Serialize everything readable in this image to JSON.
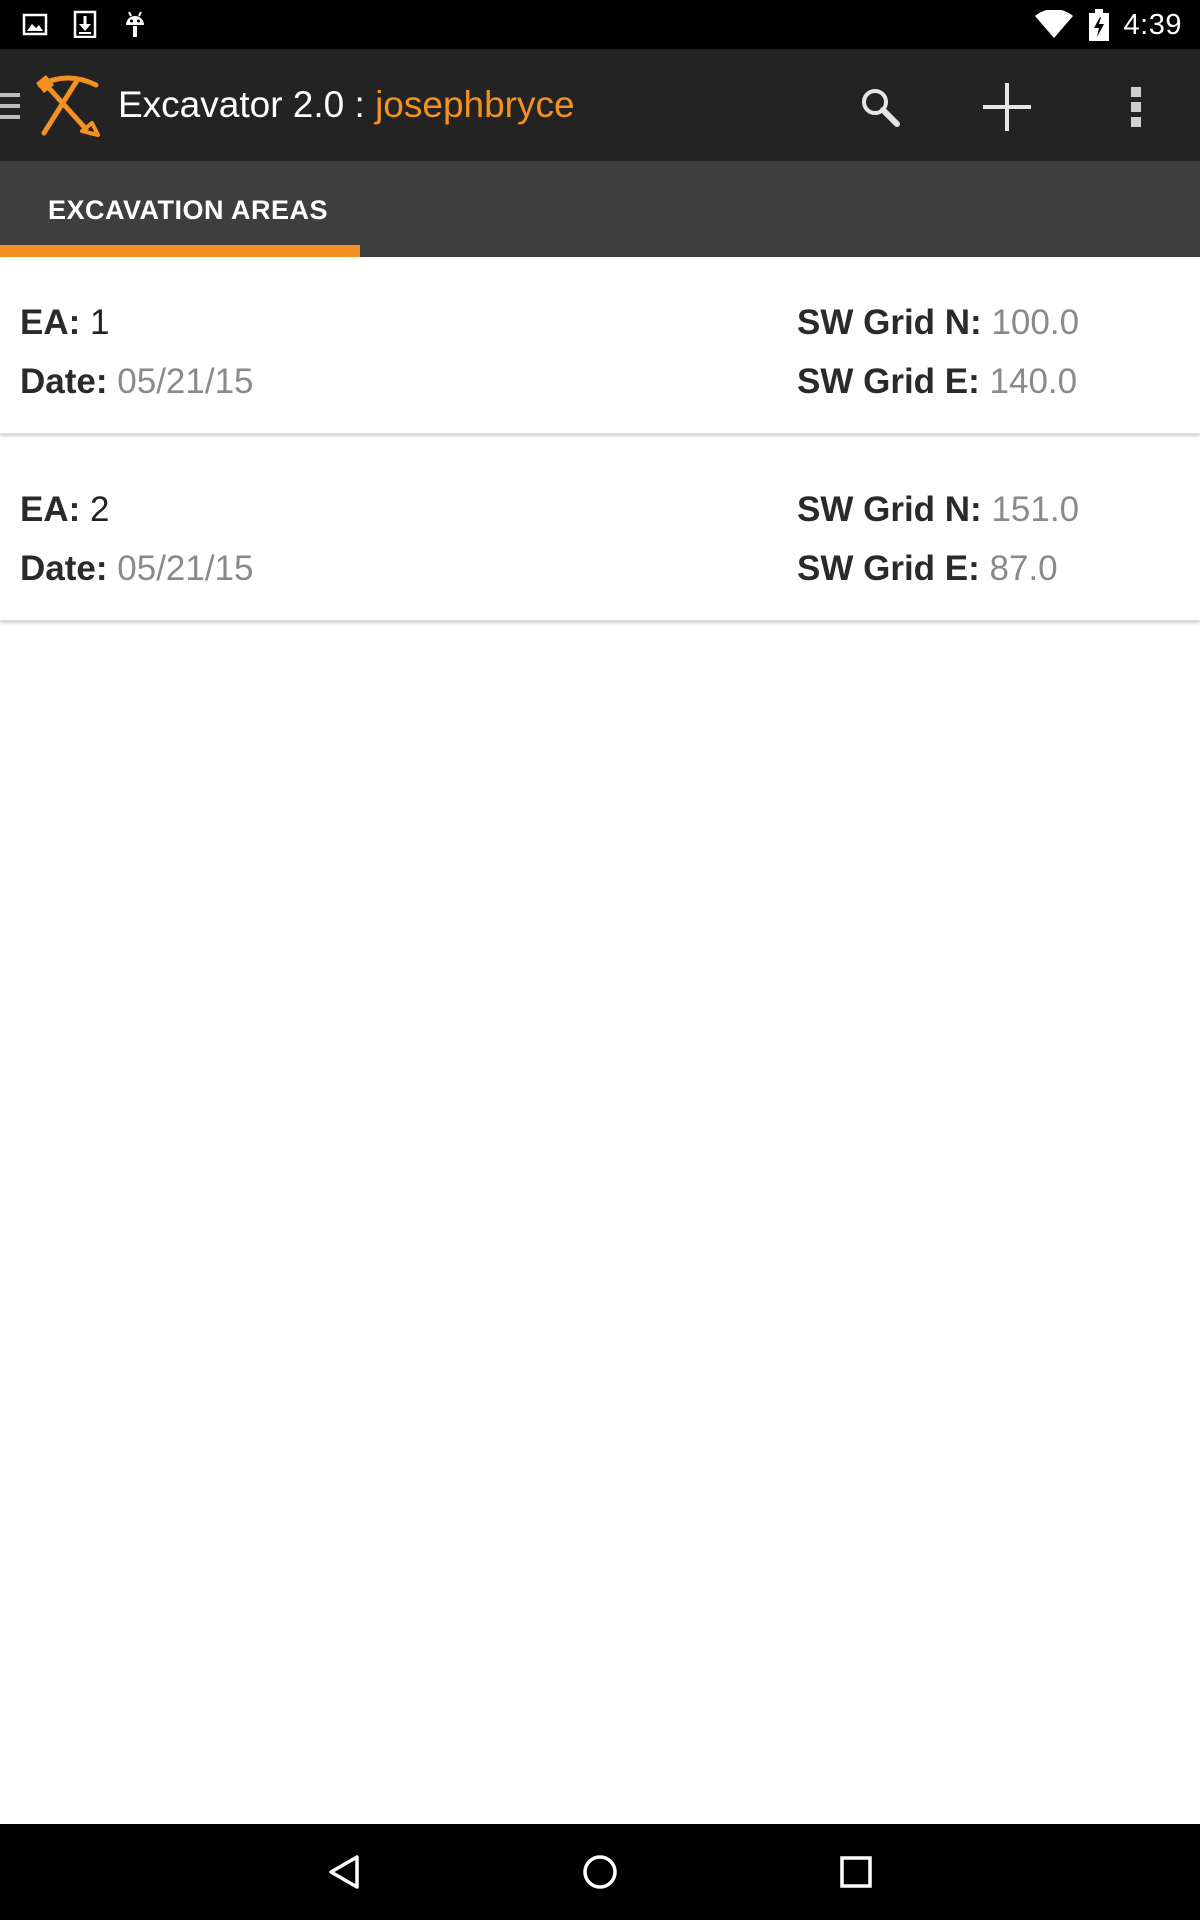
{
  "status_bar": {
    "time": "4:39",
    "notification_icons": [
      "image-icon",
      "download-icon",
      "android-debug-icon"
    ],
    "system_icons": [
      "wifi-icon",
      "battery-charging-icon"
    ]
  },
  "action_bar": {
    "app_name": "Excavator 2.0",
    "separator": " : ",
    "username": "josephbryce",
    "actions": [
      "search-icon",
      "add-icon",
      "overflow-menu-icon"
    ]
  },
  "tabs": [
    {
      "label": "EXCAVATION AREAS",
      "selected": true
    }
  ],
  "excavation_areas": [
    {
      "ea_label": "EA:",
      "ea_value": "1",
      "date_label": "Date:",
      "date_value": "05/21/15",
      "grid_n_label": "SW Grid N:",
      "grid_n_value": "100.0",
      "grid_e_label": "SW Grid E:",
      "grid_e_value": "140.0"
    },
    {
      "ea_label": "EA:",
      "ea_value": "2",
      "date_label": "Date:",
      "date_value": "05/21/15",
      "grid_n_label": "SW Grid N:",
      "grid_n_value": "151.0",
      "grid_e_label": "SW Grid E:",
      "grid_e_value": "87.0"
    }
  ],
  "nav_bar": [
    "back-icon",
    "home-icon",
    "recents-icon"
  ],
  "colors": {
    "accent": "#f39220",
    "action_bar": "#232323",
    "tab_bar": "#3e3e3e",
    "label_text": "#2a2a2a",
    "value_text": "#8a8a8a"
  }
}
